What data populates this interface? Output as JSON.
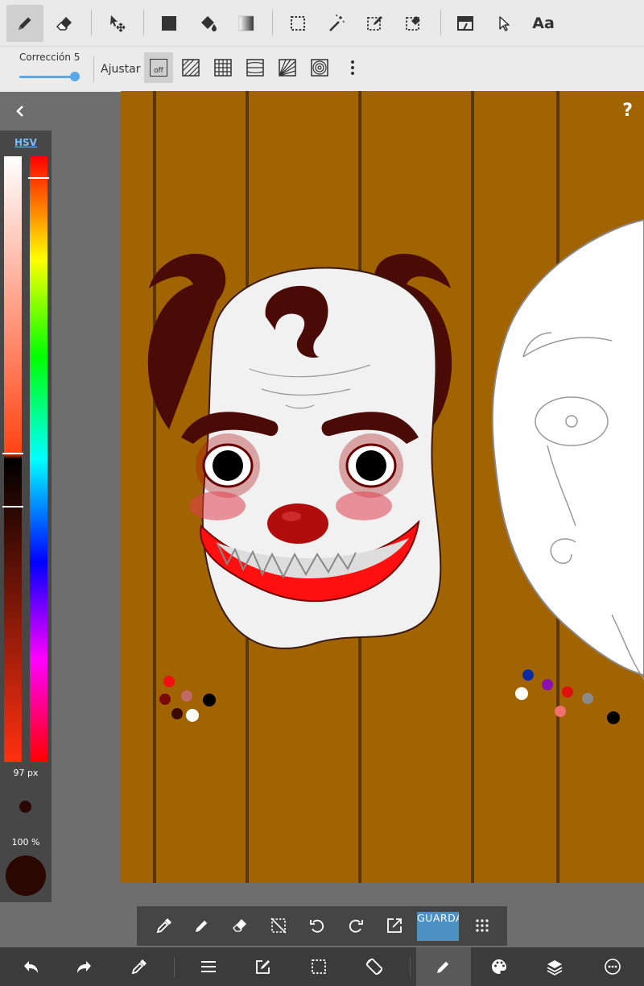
{
  "toolbar": {
    "tools": [
      "pen-tool",
      "eraser-tool",
      "move-tool",
      "fill-rect-tool",
      "bucket-fill-tool",
      "gradient-tool",
      "select-tool",
      "magic-wand-tool",
      "select-pen-tool",
      "select-eraser-tool",
      "layer-move-tool",
      "operation-tool",
      "text-tool"
    ],
    "text_tool_label": "Aa"
  },
  "subbar": {
    "correction_label": "Corrección 5",
    "correction_value": 5,
    "snap_label": "Ajustar",
    "snap_off_label": "off"
  },
  "canvas": {
    "background": "#a16400",
    "help_label": "?"
  },
  "color_panel": {
    "mode_label": "HSV",
    "brush_size_label": "97 px",
    "opacity_label": "100 %",
    "current_color": "#2a0700"
  },
  "tool_strip": {
    "save_label": "GUARDAR"
  },
  "bottom_nav": {
    "items": [
      "undo",
      "redo",
      "eyedropper",
      "menu",
      "edit",
      "selection",
      "rotate",
      "brush",
      "palette",
      "layers",
      "more"
    ]
  }
}
